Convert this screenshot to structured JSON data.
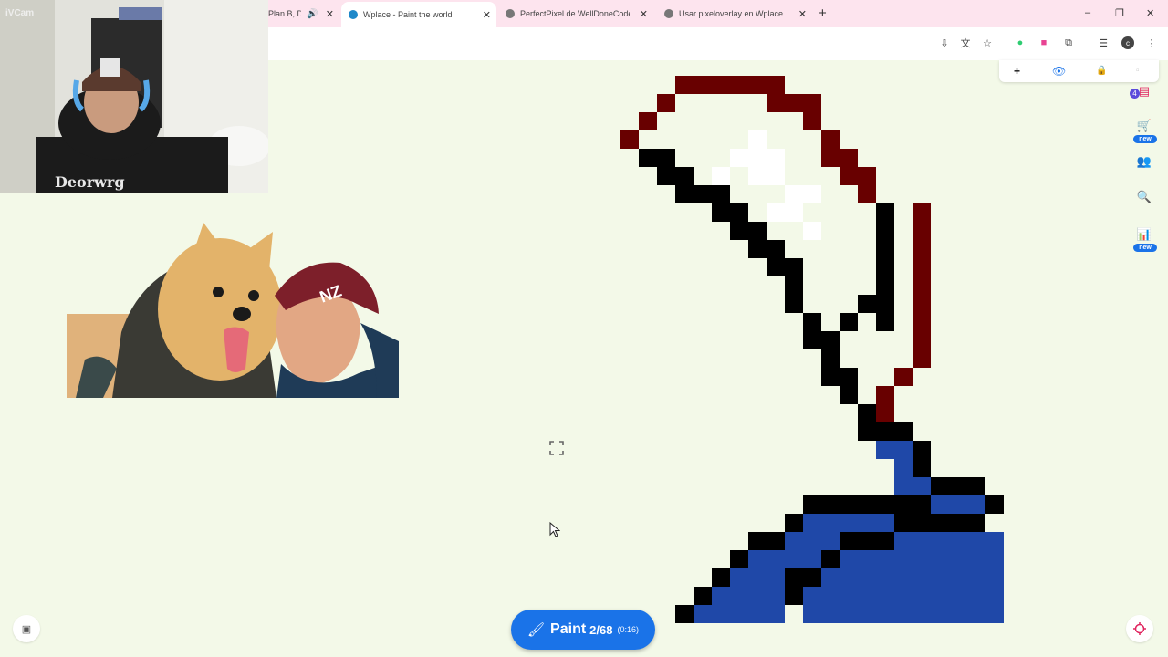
{
  "browser": {
    "tabs": [
      {
        "label": "Plan B, D",
        "has_audio": true,
        "favicon": "plan-b-favicon"
      },
      {
        "label": "Wplace - Paint the world",
        "active": true,
        "favicon": "globe-icon"
      },
      {
        "label": "PerfectPixel de WellDoneCode (",
        "favicon": "globe-icon"
      },
      {
        "label": "Usar pixeloverlay en Wplace",
        "favicon": "globe-icon"
      }
    ],
    "new_tab_glyph": "+",
    "window_controls": [
      "–",
      "❐",
      "✕"
    ]
  },
  "webcam": {
    "label": "iVCam"
  },
  "overlay_bar": {
    "add_glyph": "+"
  },
  "right_rail": {
    "notification_count": "4",
    "shop_badge": "new",
    "leaderboard_badge": "new"
  },
  "paint_button": {
    "label": "Paint",
    "count": "2/68",
    "cooldown": "(0:16)"
  },
  "colors": {
    "canvas_bg": "#f3f9e8",
    "accent": "#1a73e8",
    "pixel_black": "#000000",
    "pixel_darkred": "#680000",
    "pixel_blue": "#1f48a8",
    "pixel_white": "#ffffff"
  },
  "icons": {
    "paint": "paintbrush-icon",
    "fullscreen": "expand-icon",
    "location": "crosshair-icon",
    "map_layers": "map-icon"
  }
}
